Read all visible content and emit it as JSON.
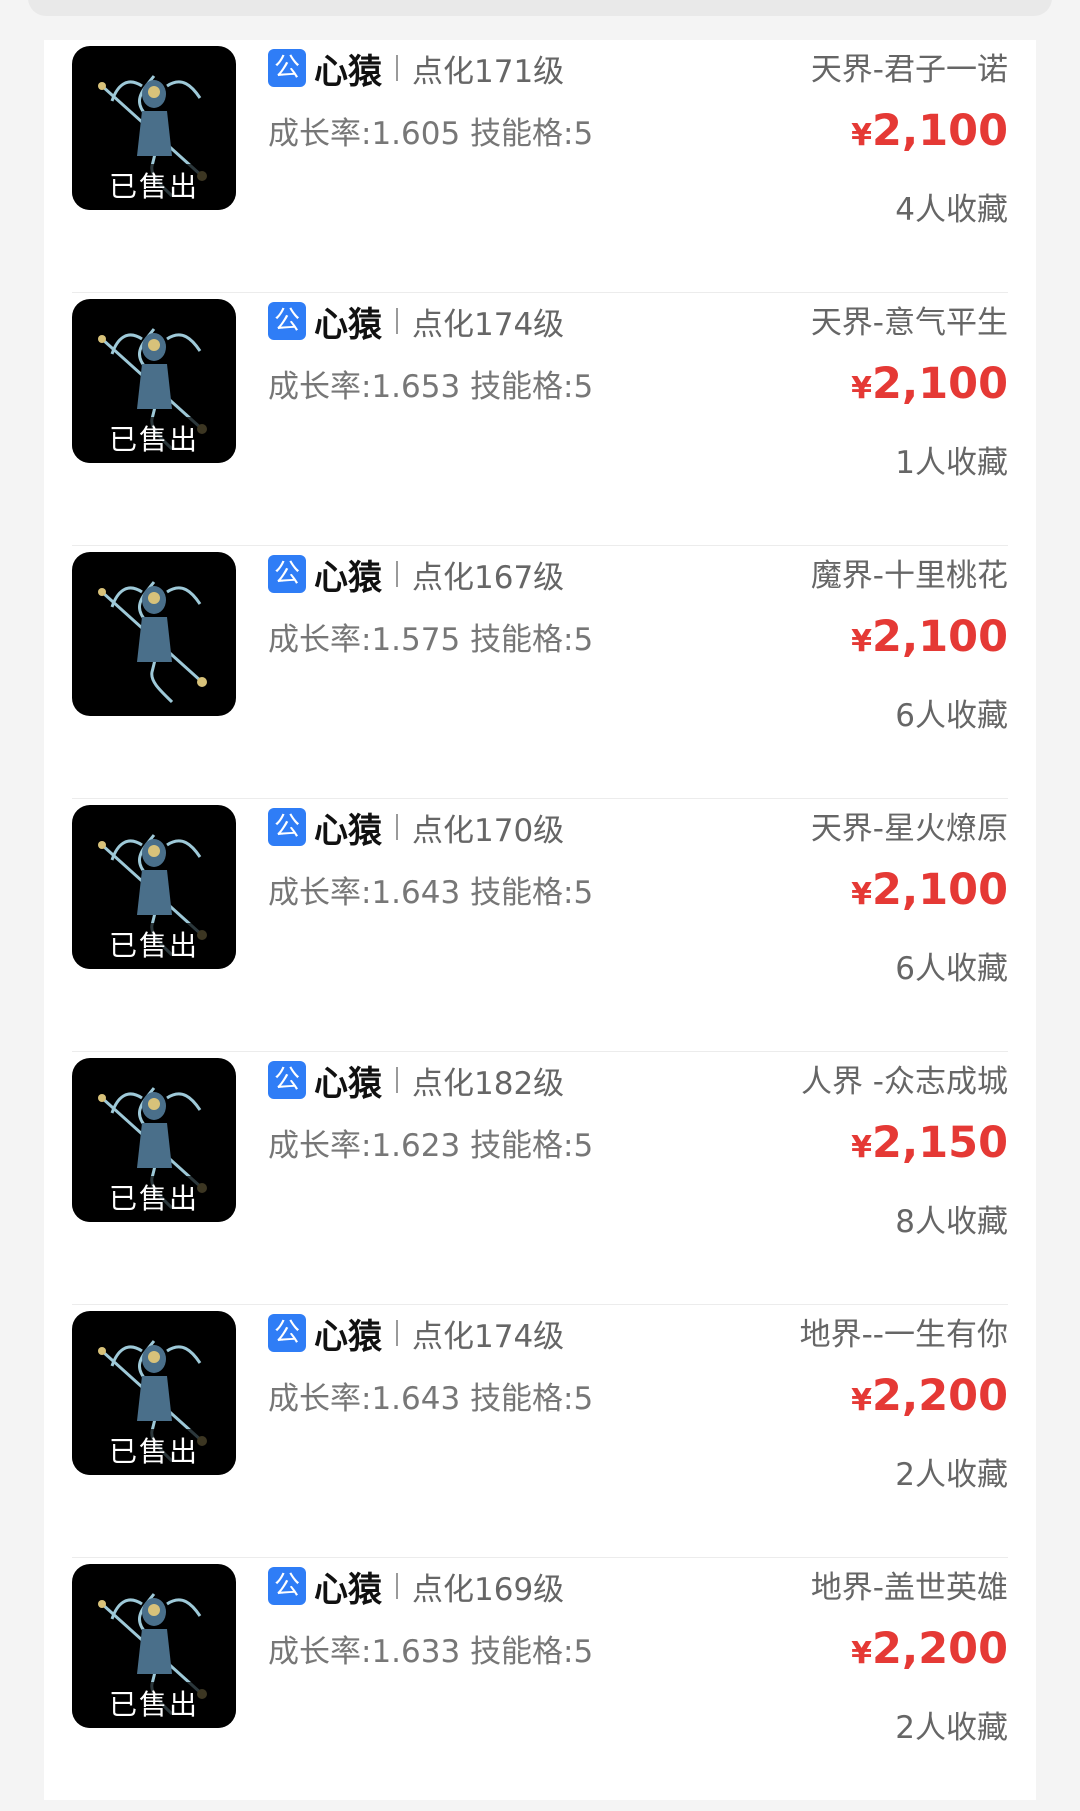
{
  "listings": [
    {
      "tag": "公",
      "name": "心猿",
      "level": "点化171级",
      "growth": "成长率:1.605",
      "skills": "技能格:5",
      "server": "天界-君子一诺",
      "currency": "¥",
      "price": "2,100",
      "favorites": "4人收藏",
      "sold": "已售出"
    },
    {
      "tag": "公",
      "name": "心猿",
      "level": "点化174级",
      "growth": "成长率:1.653",
      "skills": "技能格:5",
      "server": "天界-意气平生",
      "currency": "¥",
      "price": "2,100",
      "favorites": "1人收藏",
      "sold": "已售出"
    },
    {
      "tag": "公",
      "name": "心猿",
      "level": "点化167级",
      "growth": "成长率:1.575",
      "skills": "技能格:5",
      "server": "魔界-十里桃花",
      "currency": "¥",
      "price": "2,100",
      "favorites": "6人收藏",
      "sold": ""
    },
    {
      "tag": "公",
      "name": "心猿",
      "level": "点化170级",
      "growth": "成长率:1.643",
      "skills": "技能格:5",
      "server": "天界-星火燎原",
      "currency": "¥",
      "price": "2,100",
      "favorites": "6人收藏",
      "sold": "已售出"
    },
    {
      "tag": "公",
      "name": "心猿",
      "level": "点化182级",
      "growth": "成长率:1.623",
      "skills": "技能格:5",
      "server": "人界 -众志成城",
      "currency": "¥",
      "price": "2,150",
      "favorites": "8人收藏",
      "sold": "已售出"
    },
    {
      "tag": "公",
      "name": "心猿",
      "level": "点化174级",
      "growth": "成长率:1.643",
      "skills": "技能格:5",
      "server": "地界--一生有你",
      "currency": "¥",
      "price": "2,200",
      "favorites": "2人收藏",
      "sold": "已售出"
    },
    {
      "tag": "公",
      "name": "心猿",
      "level": "点化169级",
      "growth": "成长率:1.633",
      "skills": "技能格:5",
      "server": "地界-盖世英雄",
      "currency": "¥",
      "price": "2,200",
      "favorites": "2人收藏",
      "sold": "已售出"
    }
  ],
  "colors": {
    "price": "#e53935",
    "public_tag": "#2f7df6"
  },
  "icons": {
    "thumbnail": "monkey-warrior-icon"
  }
}
